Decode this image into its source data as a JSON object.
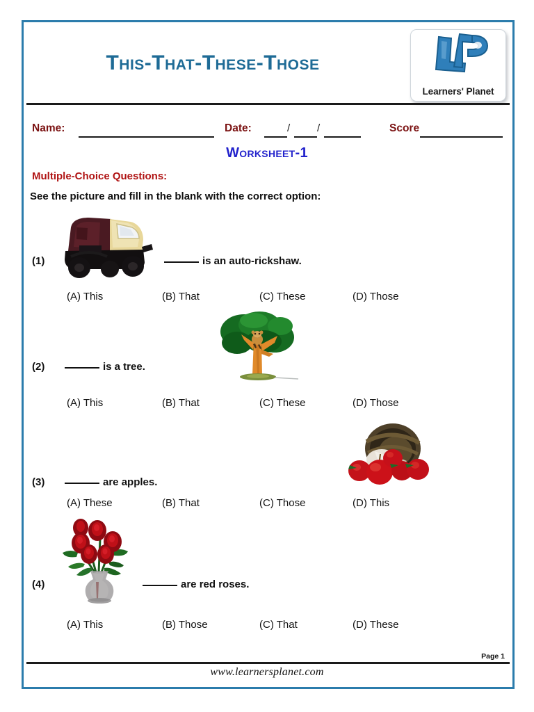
{
  "worksheet": {
    "title": "This-That-These-Those",
    "subtitle": "Worksheet-1",
    "section_heading": "Multiple-Choice Questions:",
    "instruction": "See the picture and fill in the blank with the correct option:",
    "brand": {
      "logo_mark": "lp-monogram-icon",
      "logo_text": "Learners' Planet",
      "accent_color": "#1e6b96"
    },
    "fields": [
      {
        "label": "Name:",
        "value": ""
      },
      {
        "label": "Date:",
        "value": "",
        "separators": [
          "/",
          "/"
        ]
      },
      {
        "label": "Score",
        "value": ""
      }
    ],
    "colors": {
      "frame": "#2b7cac",
      "title": "#1e6b96",
      "subtitle": "#2222cc",
      "field_label": "#7b1212",
      "section_heading": "#b01414",
      "body_text": "#111111"
    },
    "questions": [
      {
        "number": "(1)",
        "text": "is an auto-rickshaw.",
        "image": "auto-rickshaw-image",
        "options": [
          "(A) This",
          "(B) That",
          "(C) These",
          "(D) Those"
        ]
      },
      {
        "number": "(2)",
        "text": "is a tree.",
        "image": "tree-image",
        "options": [
          "(A) This",
          "(B) That",
          "(C) These",
          "(D) Those"
        ]
      },
      {
        "number": "(3)",
        "text": "are apples.",
        "image": "apples-basket-image",
        "options": [
          "(A) These",
          "(B) That",
          "(C) Those",
          "(D) This"
        ]
      },
      {
        "number": "(4)",
        "text": "are red roses.",
        "image": "red-roses-vase-image",
        "options": [
          "(A) This",
          "(B) Those",
          "(C) That",
          "(D) These"
        ]
      }
    ],
    "footer": {
      "page_label": "Page 1",
      "website": "www.learnersplanet.com"
    }
  }
}
